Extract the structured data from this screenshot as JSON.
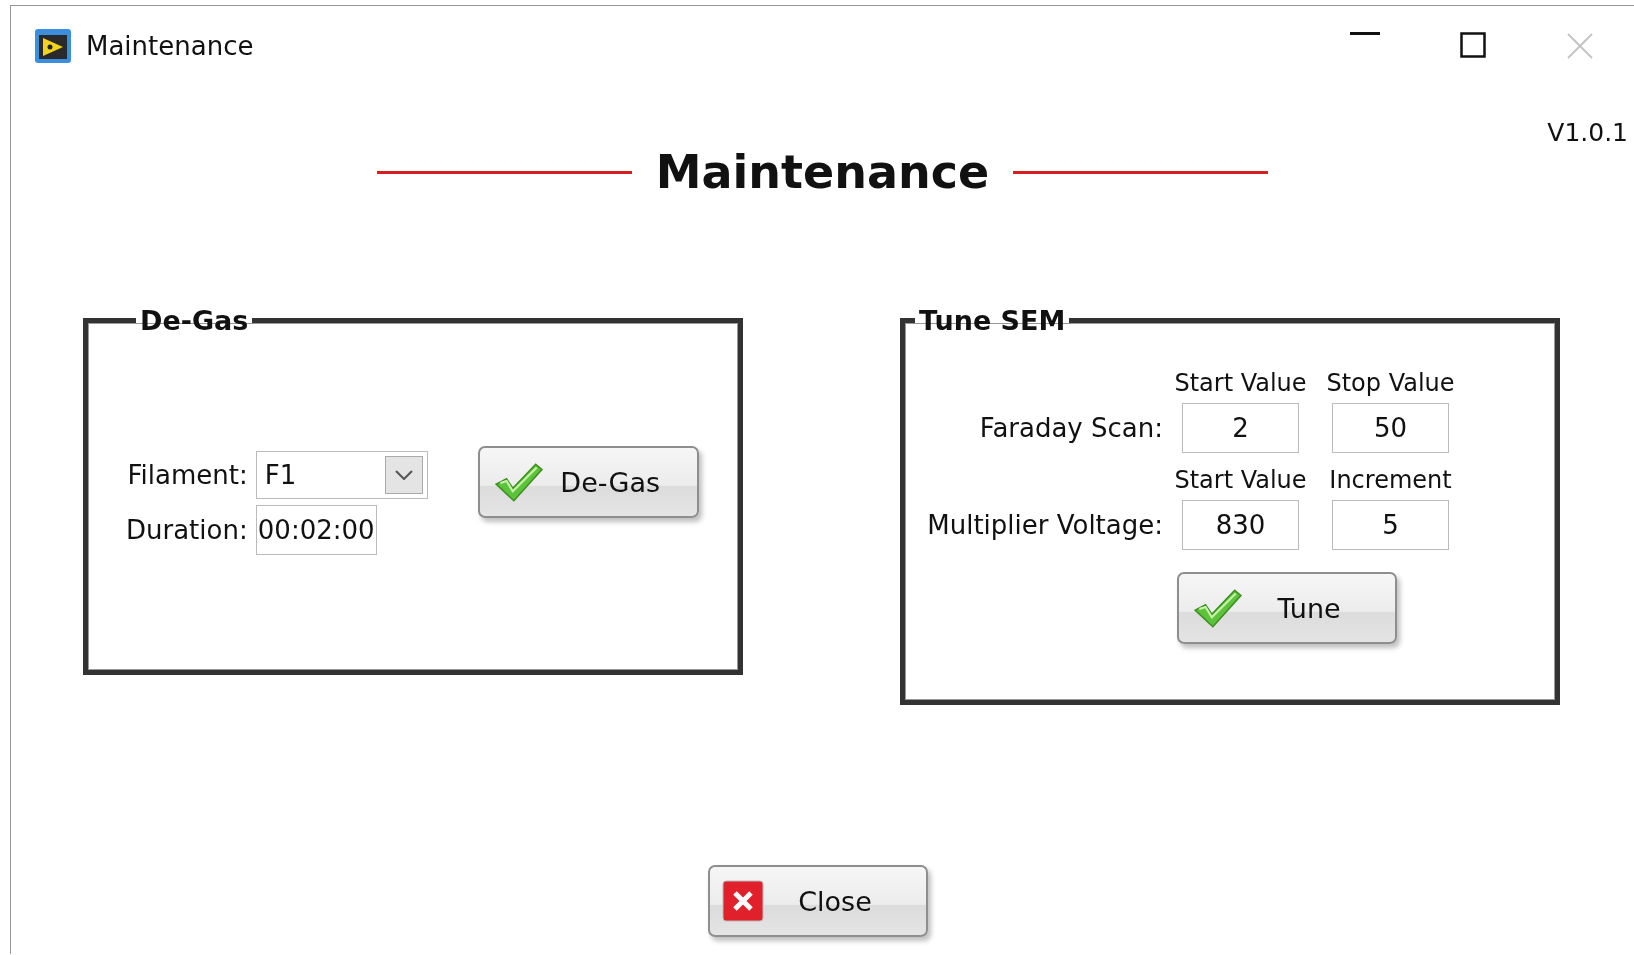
{
  "window": {
    "title": "Maintenance"
  },
  "version": "V1.0.1",
  "heading": "Maintenance",
  "degas": {
    "title": "De-Gas",
    "filament": {
      "label": "Filament:",
      "value": "F1"
    },
    "duration": {
      "label": "Duration:",
      "value": "00:02:00"
    },
    "button": "De-Gas"
  },
  "tune_sem": {
    "title": "Tune SEM",
    "rows": [
      {
        "headers": [
          "Start Value",
          "Stop Value"
        ],
        "label": "Faraday Scan:",
        "values": [
          "2",
          "50"
        ]
      },
      {
        "headers": [
          "Start Value",
          "Increment"
        ],
        "label": "Multiplier Voltage:",
        "values": [
          "830",
          "5"
        ]
      }
    ],
    "button": "Tune"
  },
  "close_button": "Close"
}
